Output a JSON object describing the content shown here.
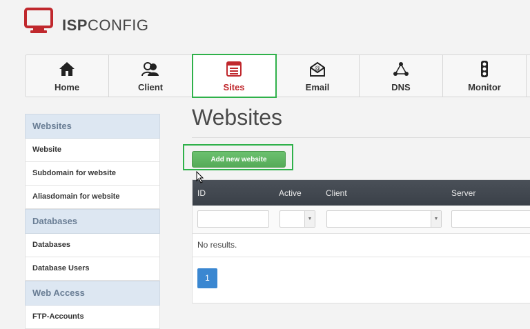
{
  "brand": {
    "bold": "ISP",
    "light": "CONFIG"
  },
  "nav": [
    {
      "label": "Home",
      "icon": "home-icon"
    },
    {
      "label": "Client",
      "icon": "client-icon"
    },
    {
      "label": "Sites",
      "icon": "sites-icon",
      "active": true
    },
    {
      "label": "Email",
      "icon": "email-icon"
    },
    {
      "label": "DNS",
      "icon": "dns-icon"
    },
    {
      "label": "Monitor",
      "icon": "monitor-icon"
    }
  ],
  "sidebar": {
    "sections": [
      {
        "heading": "Websites",
        "items": [
          "Website",
          "Subdomain for website",
          "Aliasdomain for website"
        ]
      },
      {
        "heading": "Databases",
        "items": [
          "Databases",
          "Database Users"
        ]
      },
      {
        "heading": "Web Access",
        "items": [
          "FTP-Accounts"
        ]
      }
    ]
  },
  "main": {
    "title": "Websites",
    "add_button": "Add new website",
    "table": {
      "columns": [
        "ID",
        "Active",
        "Client",
        "Server"
      ],
      "no_results": "No results.",
      "page": "1"
    }
  },
  "colors": {
    "accent": "#c0282d",
    "highlight": "#2fb14a",
    "button": "#5cb85c",
    "page_button": "#3a87d1"
  }
}
